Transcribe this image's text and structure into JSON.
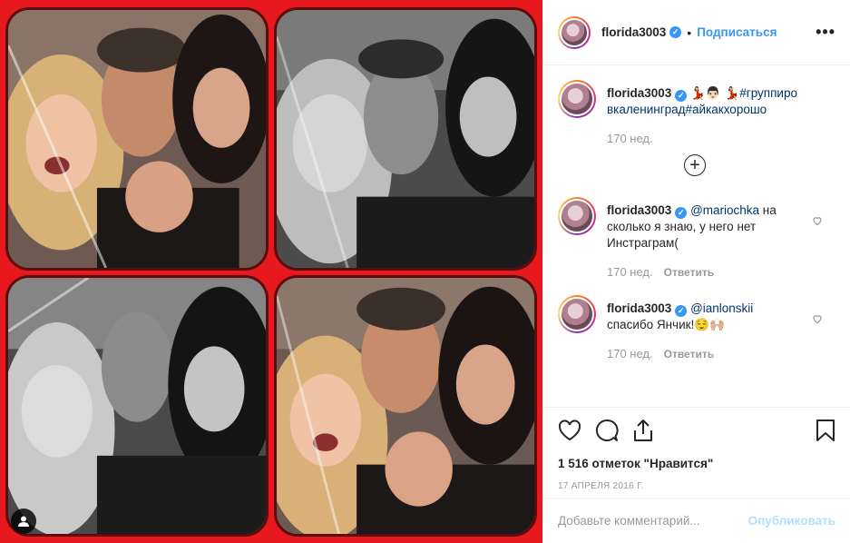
{
  "post": {
    "author": "florida3003",
    "follow_label": "Подписаться",
    "dot": "•",
    "more_label": "•••"
  },
  "caption": {
    "author": "florida3003",
    "emoji_head": "💃🏻👨🏻",
    "dancer": "💃🏻",
    "hashtags": "#группировкаленинград#айкакхорошо",
    "time": "170 нед."
  },
  "load_more_label": "+",
  "comments": [
    {
      "author": "florida3003",
      "mention": "@mariochka",
      "text": " на сколько я знаю, у него нет Инстраграм(",
      "time": "170 нед.",
      "reply_label": "Ответить"
    },
    {
      "author": "florida3003",
      "mention": "@ianlonskii",
      "text": " спасибо Янчик!😌🙌🏼",
      "time": "170 нед.",
      "reply_label": "Ответить"
    }
  ],
  "likes": "1 516 отметок \"Нравится\"",
  "date": "17 АПРЕЛЯ 2016 Г.",
  "add_comment": {
    "placeholder": "Добавьте комментарий...",
    "publish_label": "Опубликовать"
  },
  "colors": {
    "background_red": "#e8191e",
    "link_blue": "#3897f0",
    "publish_disabled": "#b2dffc"
  },
  "icons": [
    "heart-icon",
    "comment-icon",
    "share-icon",
    "bookmark-icon",
    "user-tag-icon",
    "verified-icon",
    "more-icon",
    "plus-circle-icon",
    "small-heart-icon"
  ]
}
